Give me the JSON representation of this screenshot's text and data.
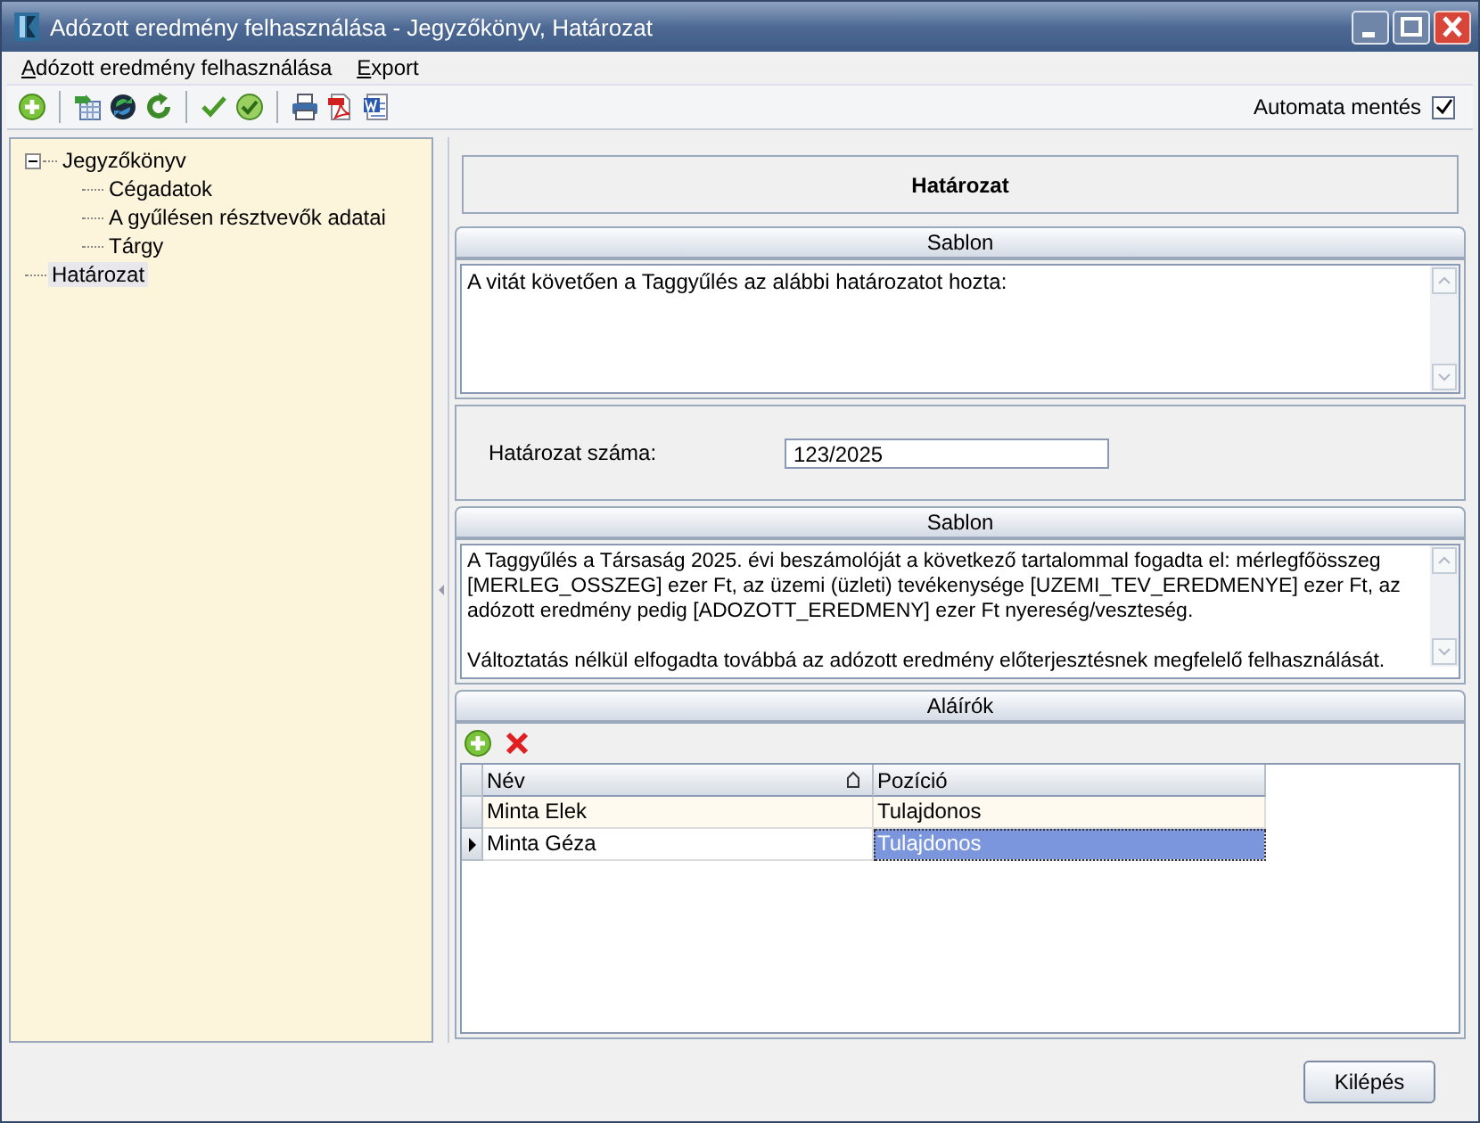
{
  "window": {
    "title": "Adózott eredmény felhasználása - Jegyzőkönyv, Határozat"
  },
  "menu": [
    {
      "label": "Adózott eredmény felhasználása"
    },
    {
      "label": "Export"
    }
  ],
  "auto_save": {
    "label": "Automata mentés",
    "checked": true
  },
  "tree": [
    {
      "label": "Jegyzőkönyv",
      "expanded": true,
      "selected": false,
      "children": [
        {
          "label": "Cégadatok",
          "selected": false
        },
        {
          "label": "A gyűlésen résztvevők adatai",
          "selected": false
        },
        {
          "label": "Tárgy",
          "selected": false
        }
      ]
    },
    {
      "label": "Határozat",
      "selected": true
    }
  ],
  "heading": "Határozat",
  "sections": [
    {
      "kind": "template",
      "title": "Sablon",
      "text": "A vitát követően a Taggyűlés az alábbi határozatot hozta:"
    },
    {
      "kind": "field",
      "label": "Határozat száma:",
      "value": "123/2025"
    },
    {
      "kind": "template",
      "title": "Sablon",
      "text": "A Taggyűlés a Társaság 2025. évi beszámolóját a következő tartalommal fogadta el: mérlegfőösszeg [MERLEG_OSSZEG] ezer Ft, az üzemi (üzleti) tevékenysége [UZEMI_TEV_EREDMENYE] ezer Ft, az adózott eredmény pedig [ADOZOTT_EREDMENY] ezer Ft nyereség/veszteség.\n\nVáltoztatás nélkül elfogadta továbbá az adózott eredmény előterjesztésnek megfelelő felhasználását."
    },
    {
      "kind": "grid",
      "title": "Aláírók",
      "columns": [
        "Név",
        "Pozíció"
      ],
      "rows": [
        {
          "cells": [
            "Minta Elek",
            "Tulajdonos"
          ],
          "selected": false
        },
        {
          "cells": [
            "Minta Géza",
            "Tulajdonos"
          ],
          "selected": true
        }
      ]
    }
  ],
  "footer": {
    "exit_button": "Kilépés"
  }
}
